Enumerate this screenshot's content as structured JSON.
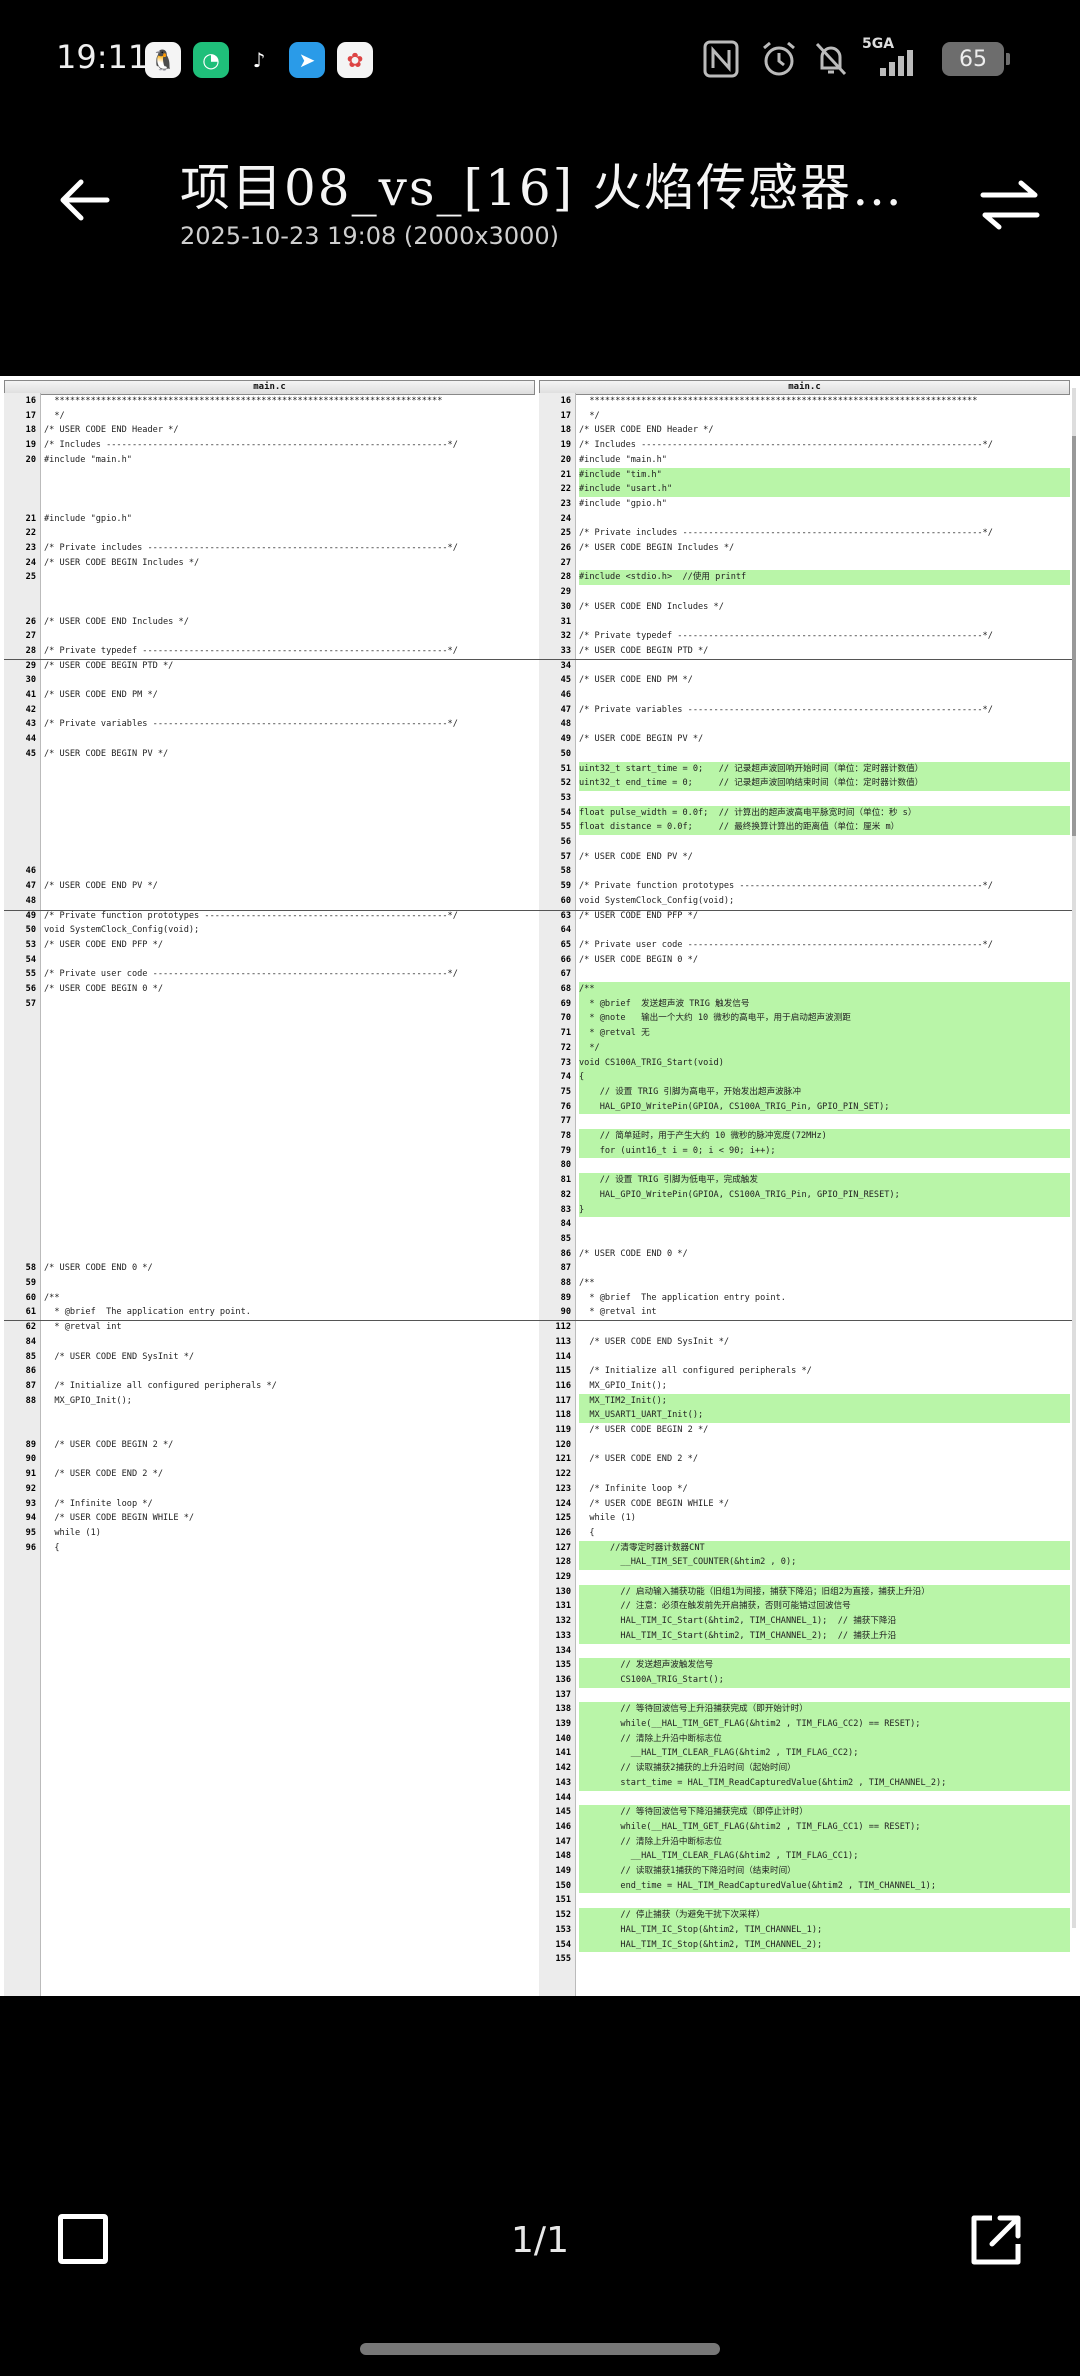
{
  "status_bar": {
    "time": "19:11",
    "network": "5GA",
    "battery": "65"
  },
  "header": {
    "title": "项目08_vs_[16] 火焰传感器…",
    "subtitle": "2025-10-23  19:08   (2000x3000)"
  },
  "footer": {
    "page_counter": "1/1"
  },
  "left_pane": {
    "title": "main.c",
    "rows": [
      {
        "ln": "16",
        "t": "  ***************************************************************************"
      },
      {
        "ln": "17",
        "t": "  */"
      },
      {
        "ln": "18",
        "t": "/* USER CODE END Header */"
      },
      {
        "ln": "19",
        "t": "/* Includes ------------------------------------------------------------------*/"
      },
      {
        "ln": "20",
        "t": "#include \"main.h\""
      },
      {
        "ln": "",
        "t": ""
      },
      {
        "ln": "",
        "t": ""
      },
      {
        "ln": "",
        "t": ""
      },
      {
        "ln": "21",
        "t": "#include \"gpio.h\""
      },
      {
        "ln": "22",
        "t": ""
      },
      {
        "ln": "23",
        "t": "/* Private includes ----------------------------------------------------------*/"
      },
      {
        "ln": "24",
        "t": "/* USER CODE BEGIN Includes */"
      },
      {
        "ln": "25",
        "t": ""
      },
      {
        "ln": "",
        "t": ""
      },
      {
        "ln": "",
        "t": ""
      },
      {
        "ln": "26",
        "t": "/* USER CODE END Includes */"
      },
      {
        "ln": "27",
        "t": ""
      },
      {
        "ln": "28",
        "t": "/* Private typedef -----------------------------------------------------------*/"
      },
      {
        "ln": "29",
        "t": "/* USER CODE BEGIN PTD */"
      },
      {
        "ln": "30",
        "t": ""
      },
      {
        "ln": "41",
        "t": "/* USER CODE END PM */"
      },
      {
        "ln": "42",
        "t": ""
      },
      {
        "ln": "43",
        "t": "/* Private variables ---------------------------------------------------------*/"
      },
      {
        "ln": "44",
        "t": ""
      },
      {
        "ln": "45",
        "t": "/* USER CODE BEGIN PV */"
      },
      {
        "ln": "",
        "t": ""
      },
      {
        "ln": "",
        "t": ""
      },
      {
        "ln": "",
        "t": ""
      },
      {
        "ln": "",
        "t": ""
      },
      {
        "ln": "",
        "t": ""
      },
      {
        "ln": "",
        "t": ""
      },
      {
        "ln": "",
        "t": ""
      },
      {
        "ln": "46",
        "t": ""
      },
      {
        "ln": "47",
        "t": "/* USER CODE END PV */"
      },
      {
        "ln": "48",
        "t": ""
      },
      {
        "ln": "49",
        "t": "/* Private function prototypes -----------------------------------------------*/"
      },
      {
        "ln": "50",
        "t": "void SystemClock_Config(void);"
      },
      {
        "ln": "53",
        "t": "/* USER CODE END PFP */"
      },
      {
        "ln": "54",
        "t": ""
      },
      {
        "ln": "55",
        "t": "/* Private user code ---------------------------------------------------------*/"
      },
      {
        "ln": "56",
        "t": "/* USER CODE BEGIN 0 */"
      },
      {
        "ln": "57",
        "t": ""
      },
      {
        "ln": "",
        "t": ""
      },
      {
        "ln": "",
        "t": ""
      },
      {
        "ln": "",
        "t": ""
      },
      {
        "ln": "",
        "t": ""
      },
      {
        "ln": "",
        "t": ""
      },
      {
        "ln": "",
        "t": ""
      },
      {
        "ln": "",
        "t": ""
      },
      {
        "ln": "",
        "t": ""
      },
      {
        "ln": "",
        "t": ""
      },
      {
        "ln": "",
        "t": ""
      },
      {
        "ln": "",
        "t": ""
      },
      {
        "ln": "",
        "t": ""
      },
      {
        "ln": "",
        "t": ""
      },
      {
        "ln": "",
        "t": ""
      },
      {
        "ln": "",
        "t": ""
      },
      {
        "ln": "",
        "t": ""
      },
      {
        "ln": "",
        "t": ""
      },
      {
        "ln": "58",
        "t": "/* USER CODE END 0 */"
      },
      {
        "ln": "59",
        "t": ""
      },
      {
        "ln": "60",
        "t": "/**"
      },
      {
        "ln": "61",
        "t": "  * @brief  The application entry point."
      },
      {
        "ln": "62",
        "t": "  * @retval int"
      },
      {
        "ln": "84",
        "t": ""
      },
      {
        "ln": "85",
        "t": "  /* USER CODE END SysInit */"
      },
      {
        "ln": "86",
        "t": ""
      },
      {
        "ln": "87",
        "t": "  /* Initialize all configured peripherals */"
      },
      {
        "ln": "88",
        "t": "  MX_GPIO_Init();"
      },
      {
        "ln": "",
        "t": ""
      },
      {
        "ln": "",
        "t": ""
      },
      {
        "ln": "89",
        "t": "  /* USER CODE BEGIN 2 */"
      },
      {
        "ln": "90",
        "t": ""
      },
      {
        "ln": "91",
        "t": "  /* USER CODE END 2 */"
      },
      {
        "ln": "92",
        "t": ""
      },
      {
        "ln": "93",
        "t": "  /* Infinite loop */"
      },
      {
        "ln": "94",
        "t": "  /* USER CODE BEGIN WHILE */"
      },
      {
        "ln": "95",
        "t": "  while (1)"
      },
      {
        "ln": "96",
        "t": "  {"
      }
    ]
  },
  "right_pane": {
    "title": "main.c",
    "rows": [
      {
        "ln": "16",
        "t": "  ***************************************************************************",
        "a": false
      },
      {
        "ln": "17",
        "t": "  */",
        "a": false
      },
      {
        "ln": "18",
        "t": "/* USER CODE END Header */",
        "a": false
      },
      {
        "ln": "19",
        "t": "/* Includes ------------------------------------------------------------------*/",
        "a": false
      },
      {
        "ln": "20",
        "t": "#include \"main.h\"",
        "a": false
      },
      {
        "ln": "21",
        "t": "#include \"tim.h\"",
        "a": true
      },
      {
        "ln": "22",
        "t": "#include \"usart.h\"",
        "a": true
      },
      {
        "ln": "23",
        "t": "#include \"gpio.h\"",
        "a": false
      },
      {
        "ln": "24",
        "t": "",
        "a": false
      },
      {
        "ln": "25",
        "t": "/* Private includes ----------------------------------------------------------*/",
        "a": false
      },
      {
        "ln": "26",
        "t": "/* USER CODE BEGIN Includes */",
        "a": false
      },
      {
        "ln": "27",
        "t": "",
        "a": false
      },
      {
        "ln": "28",
        "t": "#include <stdio.h>  //使用 printf",
        "a": true
      },
      {
        "ln": "29",
        "t": "",
        "a": true
      },
      {
        "ln": "30",
        "t": "/* USER CODE END Includes */",
        "a": false
      },
      {
        "ln": "31",
        "t": "",
        "a": false
      },
      {
        "ln": "32",
        "t": "/* Private typedef -----------------------------------------------------------*/",
        "a": false
      },
      {
        "ln": "33",
        "t": "/* USER CODE BEGIN PTD */",
        "a": false
      },
      {
        "ln": "34",
        "t": "",
        "a": false
      },
      {
        "ln": "45",
        "t": "/* USER CODE END PM */",
        "a": false
      },
      {
        "ln": "46",
        "t": "",
        "a": false
      },
      {
        "ln": "47",
        "t": "/* Private variables ---------------------------------------------------------*/",
        "a": false
      },
      {
        "ln": "48",
        "t": "",
        "a": false
      },
      {
        "ln": "49",
        "t": "/* USER CODE BEGIN PV */",
        "a": false
      },
      {
        "ln": "50",
        "t": "",
        "a": true
      },
      {
        "ln": "51",
        "t": "uint32_t start_time = 0;   // 记录超声波回响开始时间（单位：定时器计数值）",
        "a": true
      },
      {
        "ln": "52",
        "t": "uint32_t end_time = 0;     // 记录超声波回响结束时间（单位：定时器计数值）",
        "a": true
      },
      {
        "ln": "53",
        "t": "",
        "a": true
      },
      {
        "ln": "54",
        "t": "float pulse_width = 0.0f;  // 计算出的超声波高电平脉宽时间（单位：秒 s）",
        "a": true
      },
      {
        "ln": "55",
        "t": "float distance = 0.0f;     // 最终换算计算出的距离值（单位：厘米 m）",
        "a": true
      },
      {
        "ln": "56",
        "t": "",
        "a": false
      },
      {
        "ln": "57",
        "t": "/* USER CODE END PV */",
        "a": false
      },
      {
        "ln": "58",
        "t": "",
        "a": false
      },
      {
        "ln": "59",
        "t": "/* Private function prototypes -----------------------------------------------*/",
        "a": false
      },
      {
        "ln": "60",
        "t": "void SystemClock_Config(void);",
        "a": false
      },
      {
        "ln": "63",
        "t": "/* USER CODE END PFP */",
        "a": false
      },
      {
        "ln": "64",
        "t": "",
        "a": false
      },
      {
        "ln": "65",
        "t": "/* Private user code ---------------------------------------------------------*/",
        "a": false
      },
      {
        "ln": "66",
        "t": "/* USER CODE BEGIN 0 */",
        "a": false
      },
      {
        "ln": "67",
        "t": "",
        "a": false
      },
      {
        "ln": "68",
        "t": "/**",
        "a": true
      },
      {
        "ln": "69",
        "t": "  * @brief  发送超声波 TRIG 触发信号",
        "a": true
      },
      {
        "ln": "70",
        "t": "  * @note   输出一个大约 10 微秒的高电平，用于启动超声波测距",
        "a": true
      },
      {
        "ln": "71",
        "t": "  * @retval 无",
        "a": true
      },
      {
        "ln": "72",
        "t": "  */",
        "a": true
      },
      {
        "ln": "73",
        "t": "void CS100A_TRIG_Start(void)",
        "a": true
      },
      {
        "ln": "74",
        "t": "{",
        "a": true
      },
      {
        "ln": "75",
        "t": "    // 设置 TRIG 引脚为高电平，开始发出超声波脉冲",
        "a": true
      },
      {
        "ln": "76",
        "t": "    HAL_GPIO_WritePin(GPIOA, CS100A_TRIG_Pin, GPIO_PIN_SET);",
        "a": true
      },
      {
        "ln": "77",
        "t": "",
        "a": true
      },
      {
        "ln": "78",
        "t": "    // 简单延时，用于产生大约 10 微秒的脉冲宽度(72MHz)",
        "a": true
      },
      {
        "ln": "79",
        "t": "    for (uint16_t i = 0; i < 90; i++);",
        "a": true
      },
      {
        "ln": "80",
        "t": "",
        "a": true
      },
      {
        "ln": "81",
        "t": "    // 设置 TRIG 引脚为低电平，完成触发",
        "a": true
      },
      {
        "ln": "82",
        "t": "    HAL_GPIO_WritePin(GPIOA, CS100A_TRIG_Pin, GPIO_PIN_RESET);",
        "a": true
      },
      {
        "ln": "83",
        "t": "}",
        "a": true
      },
      {
        "ln": "84",
        "t": "",
        "a": true
      },
      {
        "ln": "85",
        "t": "",
        "a": true
      },
      {
        "ln": "86",
        "t": "/* USER CODE END 0 */",
        "a": false
      },
      {
        "ln": "87",
        "t": "",
        "a": false
      },
      {
        "ln": "88",
        "t": "/**",
        "a": false
      },
      {
        "ln": "89",
        "t": "  * @brief  The application entry point.",
        "a": false
      },
      {
        "ln": "90",
        "t": "  * @retval int",
        "a": false
      },
      {
        "ln": "112",
        "t": "",
        "a": false
      },
      {
        "ln": "113",
        "t": "  /* USER CODE END SysInit */",
        "a": false
      },
      {
        "ln": "114",
        "t": "",
        "a": false
      },
      {
        "ln": "115",
        "t": "  /* Initialize all configured peripherals */",
        "a": false
      },
      {
        "ln": "116",
        "t": "  MX_GPIO_Init();",
        "a": false
      },
      {
        "ln": "117",
        "t": "  MX_TIM2_Init();",
        "a": true
      },
      {
        "ln": "118",
        "t": "  MX_USART1_UART_Init();",
        "a": true
      },
      {
        "ln": "119",
        "t": "  /* USER CODE BEGIN 2 */",
        "a": false
      },
      {
        "ln": "120",
        "t": "",
        "a": false
      },
      {
        "ln": "121",
        "t": "  /* USER CODE END 2 */",
        "a": false
      },
      {
        "ln": "122",
        "t": "",
        "a": false
      },
      {
        "ln": "123",
        "t": "  /* Infinite loop */",
        "a": false
      },
      {
        "ln": "124",
        "t": "  /* USER CODE BEGIN WHILE */",
        "a": false
      },
      {
        "ln": "125",
        "t": "  while (1)",
        "a": false
      },
      {
        "ln": "126",
        "t": "  {",
        "a": false
      },
      {
        "ln": "127",
        "t": "      //清零定时器计数器CNT",
        "a": true
      },
      {
        "ln": "128",
        "t": "        __HAL_TIM_SET_COUNTER(&htim2 , 0);",
        "a": true
      },
      {
        "ln": "129",
        "t": "",
        "a": true
      },
      {
        "ln": "130",
        "t": "        // 启动输入捕获功能（旧组1为间接，捕获下降沿；旧组2为直接，捕获上升沿）",
        "a": true
      },
      {
        "ln": "131",
        "t": "        // 注意：必须在触发前先开启捕获，否则可能错过回波信号",
        "a": true
      },
      {
        "ln": "132",
        "t": "        HAL_TIM_IC_Start(&htim2, TIM_CHANNEL_1);  // 捕获下降沿",
        "a": true
      },
      {
        "ln": "133",
        "t": "        HAL_TIM_IC_Start(&htim2, TIM_CHANNEL_2);  // 捕获上升沿",
        "a": true
      },
      {
        "ln": "134",
        "t": "",
        "a": true
      },
      {
        "ln": "135",
        "t": "        // 发送超声波触发信号",
        "a": true
      },
      {
        "ln": "136",
        "t": "        CS100A_TRIG_Start();",
        "a": true
      },
      {
        "ln": "137",
        "t": "",
        "a": true
      },
      {
        "ln": "138",
        "t": "        // 等待回波信号上升沿捕获完成（即开始计时）",
        "a": true
      },
      {
        "ln": "139",
        "t": "        while(__HAL_TIM_GET_FLAG(&htim2 , TIM_FLAG_CC2) == RESET);",
        "a": true
      },
      {
        "ln": "140",
        "t": "        // 清除上升沿中断标志位",
        "a": true
      },
      {
        "ln": "141",
        "t": "          __HAL_TIM_CLEAR_FLAG(&htim2 , TIM_FLAG_CC2);",
        "a": true
      },
      {
        "ln": "142",
        "t": "        // 读取捕获2捕获的上升沿时间（起始时间）",
        "a": true
      },
      {
        "ln": "143",
        "t": "        start_time = HAL_TIM_ReadCapturedValue(&htim2 , TIM_CHANNEL_2);",
        "a": true
      },
      {
        "ln": "144",
        "t": "",
        "a": true
      },
      {
        "ln": "145",
        "t": "        // 等待回波信号下降沿捕获完成（即停止计时）",
        "a": true
      },
      {
        "ln": "146",
        "t": "        while(__HAL_TIM_GET_FLAG(&htim2 , TIM_FLAG_CC1) == RESET);",
        "a": true
      },
      {
        "ln": "147",
        "t": "        // 清除上升沿中断标志位",
        "a": true
      },
      {
        "ln": "148",
        "t": "          __HAL_TIM_CLEAR_FLAG(&htim2 , TIM_FLAG_CC1);",
        "a": true
      },
      {
        "ln": "149",
        "t": "        // 读取捕获1捕获的下降沿时间（结束时间）",
        "a": true
      },
      {
        "ln": "150",
        "t": "        end_time = HAL_TIM_ReadCapturedValue(&htim2 , TIM_CHANNEL_1);",
        "a": true
      },
      {
        "ln": "151",
        "t": "",
        "a": true
      },
      {
        "ln": "152",
        "t": "        // 停止捕获（为避免干扰下次采样）",
        "a": true
      },
      {
        "ln": "153",
        "t": "        HAL_TIM_IC_Stop(&htim2, TIM_CHANNEL_1);",
        "a": true
      },
      {
        "ln": "154",
        "t": "        HAL_TIM_IC_Stop(&htim2, TIM_CHANNEL_2);",
        "a": true
      },
      {
        "ln": "155",
        "t": "",
        "a": true
      }
    ]
  }
}
